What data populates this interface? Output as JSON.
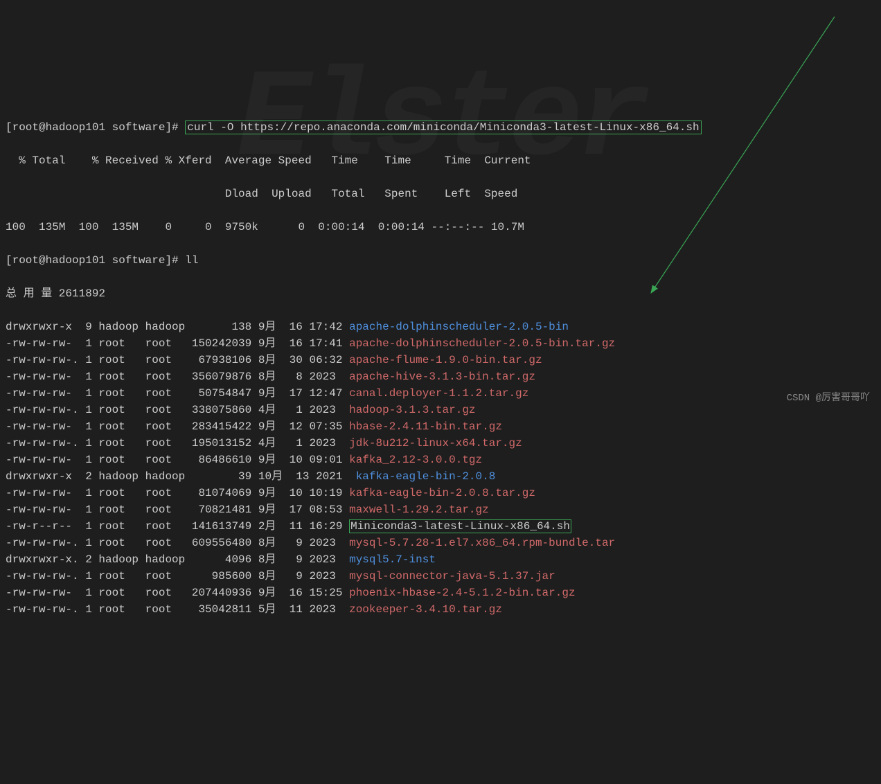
{
  "prompt": "[root@hadoop101 software]#",
  "curl_cmd": "curl -O https://repo.anaconda.com/miniconda/Miniconda3-latest-Linux-x86_64.sh",
  "curl_headers": "  % Total    % Received % Xferd  Average Speed   Time    Time     Time  Current",
  "curl_headers2": "                                 Dload  Upload   Total   Spent    Left  Speed",
  "curl_progress": "100  135M  100  135M    0     0  9750k      0  0:00:14  0:00:14 --:--:-- 10.7M",
  "ll_cmd": "ll",
  "total_label": "总 用 量 2611892",
  "rows": [
    {
      "perm": "drwxrwxr-x",
      "n": "9",
      "u": "hadoop",
      "g": "hadoop",
      "sz": "138",
      "mo": "9月",
      "dy": "16",
      "tm": "17:42",
      "nm": "apache-dolphinscheduler-2.0.5-bin",
      "cls": "dir-color"
    },
    {
      "perm": "-rw-rw-rw-",
      "n": "1",
      "u": "root",
      "g": "root",
      "sz": "150242039",
      "mo": "9月",
      "dy": "16",
      "tm": "17:41",
      "nm": "apache-dolphinscheduler-2.0.5-bin.tar.gz",
      "cls": "file-red"
    },
    {
      "perm": "-rw-rw-rw-.",
      "n": "1",
      "u": "root",
      "g": "root",
      "sz": "67938106",
      "mo": "8月",
      "dy": "30",
      "tm": "06:32",
      "nm": "apache-flume-1.9.0-bin.tar.gz",
      "cls": "file-red"
    },
    {
      "perm": "-rw-rw-rw-",
      "n": "1",
      "u": "root",
      "g": "root",
      "sz": "356079876",
      "mo": "8月",
      "dy": "8",
      "tm": "2023",
      "nm": "apache-hive-3.1.3-bin.tar.gz",
      "cls": "file-red"
    },
    {
      "perm": "-rw-rw-rw-",
      "n": "1",
      "u": "root",
      "g": "root",
      "sz": "50754847",
      "mo": "9月",
      "dy": "17",
      "tm": "12:47",
      "nm": "canal.deployer-1.1.2.tar.gz",
      "cls": "file-red"
    },
    {
      "perm": "-rw-rw-rw-.",
      "n": "1",
      "u": "root",
      "g": "root",
      "sz": "338075860",
      "mo": "4月",
      "dy": "1",
      "tm": "2023",
      "nm": "hadoop-3.1.3.tar.gz",
      "cls": "file-red"
    },
    {
      "perm": "-rw-rw-rw-",
      "n": "1",
      "u": "root",
      "g": "root",
      "sz": "283415422",
      "mo": "9月",
      "dy": "12",
      "tm": "07:35",
      "nm": "hbase-2.4.11-bin.tar.gz",
      "cls": "file-red"
    },
    {
      "perm": "-rw-rw-rw-.",
      "n": "1",
      "u": "root",
      "g": "root",
      "sz": "195013152",
      "mo": "4月",
      "dy": "1",
      "tm": "2023",
      "nm": "jdk-8u212-linux-x64.tar.gz",
      "cls": "file-red"
    },
    {
      "perm": "-rw-rw-rw-",
      "n": "1",
      "u": "root",
      "g": "root",
      "sz": "86486610",
      "mo": "9月",
      "dy": "10",
      "tm": "09:01",
      "nm": "kafka_2.12-3.0.0.tgz",
      "cls": "file-red"
    },
    {
      "perm": "drwxrwxr-x",
      "n": "2",
      "u": "hadoop",
      "g": "hadoop",
      "sz": "39",
      "mo": "10月",
      "dy": "13",
      "tm": "2021",
      "nm": "kafka-eagle-bin-2.0.8",
      "cls": "dir-color"
    },
    {
      "perm": "-rw-rw-rw-",
      "n": "1",
      "u": "root",
      "g": "root",
      "sz": "81074069",
      "mo": "9月",
      "dy": "10",
      "tm": "10:19",
      "nm": "kafka-eagle-bin-2.0.8.tar.gz",
      "cls": "file-red"
    },
    {
      "perm": "-rw-rw-rw-",
      "n": "1",
      "u": "root",
      "g": "root",
      "sz": "70821481",
      "mo": "9月",
      "dy": "17",
      "tm": "08:53",
      "nm": "maxwell-1.29.2.tar.gz",
      "cls": "file-red"
    },
    {
      "perm": "-rw-r--r--",
      "n": "1",
      "u": "root",
      "g": "root",
      "sz": "141613749",
      "mo": "2月",
      "dy": "11",
      "tm": "16:29",
      "nm": "Miniconda3-latest-Linux-x86_64.sh",
      "cls": "box"
    },
    {
      "perm": "-rw-rw-rw-.",
      "n": "1",
      "u": "root",
      "g": "root",
      "sz": "609556480",
      "mo": "8月",
      "dy": "9",
      "tm": "2023",
      "nm": "mysql-5.7.28-1.el7.x86_64.rpm-bundle.tar",
      "cls": "file-red"
    },
    {
      "perm": "drwxrwxr-x.",
      "n": "2",
      "u": "hadoop",
      "g": "hadoop",
      "sz": "4096",
      "mo": "8月",
      "dy": "9",
      "tm": "2023",
      "nm": "mysql5.7-inst",
      "cls": "dir-color"
    },
    {
      "perm": "-rw-rw-rw-.",
      "n": "1",
      "u": "root",
      "g": "root",
      "sz": "985600",
      "mo": "8月",
      "dy": "9",
      "tm": "2023",
      "nm": "mysql-connector-java-5.1.37.jar",
      "cls": "file-red"
    },
    {
      "perm": "-rw-rw-rw-",
      "n": "1",
      "u": "root",
      "g": "root",
      "sz": "207440936",
      "mo": "9月",
      "dy": "16",
      "tm": "15:25",
      "nm": "phoenix-hbase-2.4-5.1.2-bin.tar.gz",
      "cls": "file-red"
    },
    {
      "perm": "-rw-rw-rw-.",
      "n": "1",
      "u": "root",
      "g": "root",
      "sz": "35042811",
      "mo": "5月",
      "dy": "11",
      "tm": "2023",
      "nm": "zookeeper-3.4.10.tar.gz",
      "cls": "file-red"
    }
  ],
  "credit": "CSDN @厉害哥哥吖"
}
